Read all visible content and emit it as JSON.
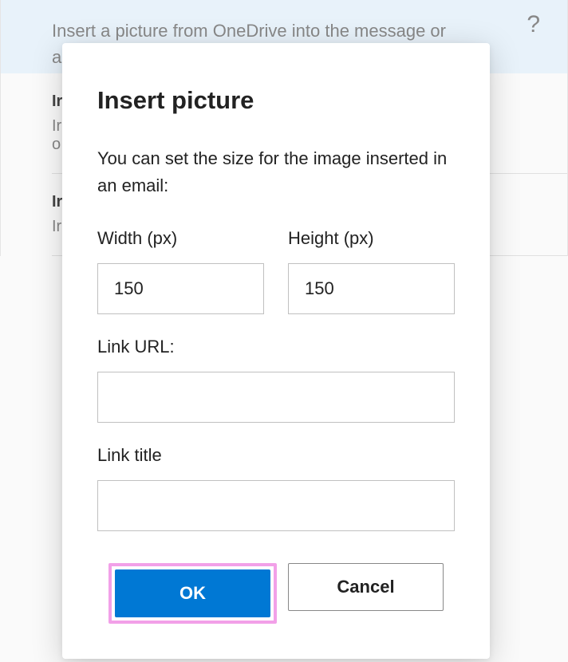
{
  "background": {
    "header_text": "Insert a picture from OneDrive into the message or appointment body.",
    "items": [
      {
        "title": "Ir",
        "desc1": "Ir",
        "desc2": "o"
      },
      {
        "title": "Ir",
        "desc1": "Ir"
      }
    ]
  },
  "modal": {
    "title": "Insert picture",
    "description": "You can set the size for the image inserted in an email:",
    "width": {
      "label": "Width (px)",
      "value": "150"
    },
    "height": {
      "label": "Height (px)",
      "value": "150"
    },
    "link_url": {
      "label": "Link URL:",
      "value": ""
    },
    "link_title": {
      "label": "Link title",
      "value": ""
    },
    "ok_label": "OK",
    "cancel_label": "Cancel"
  }
}
